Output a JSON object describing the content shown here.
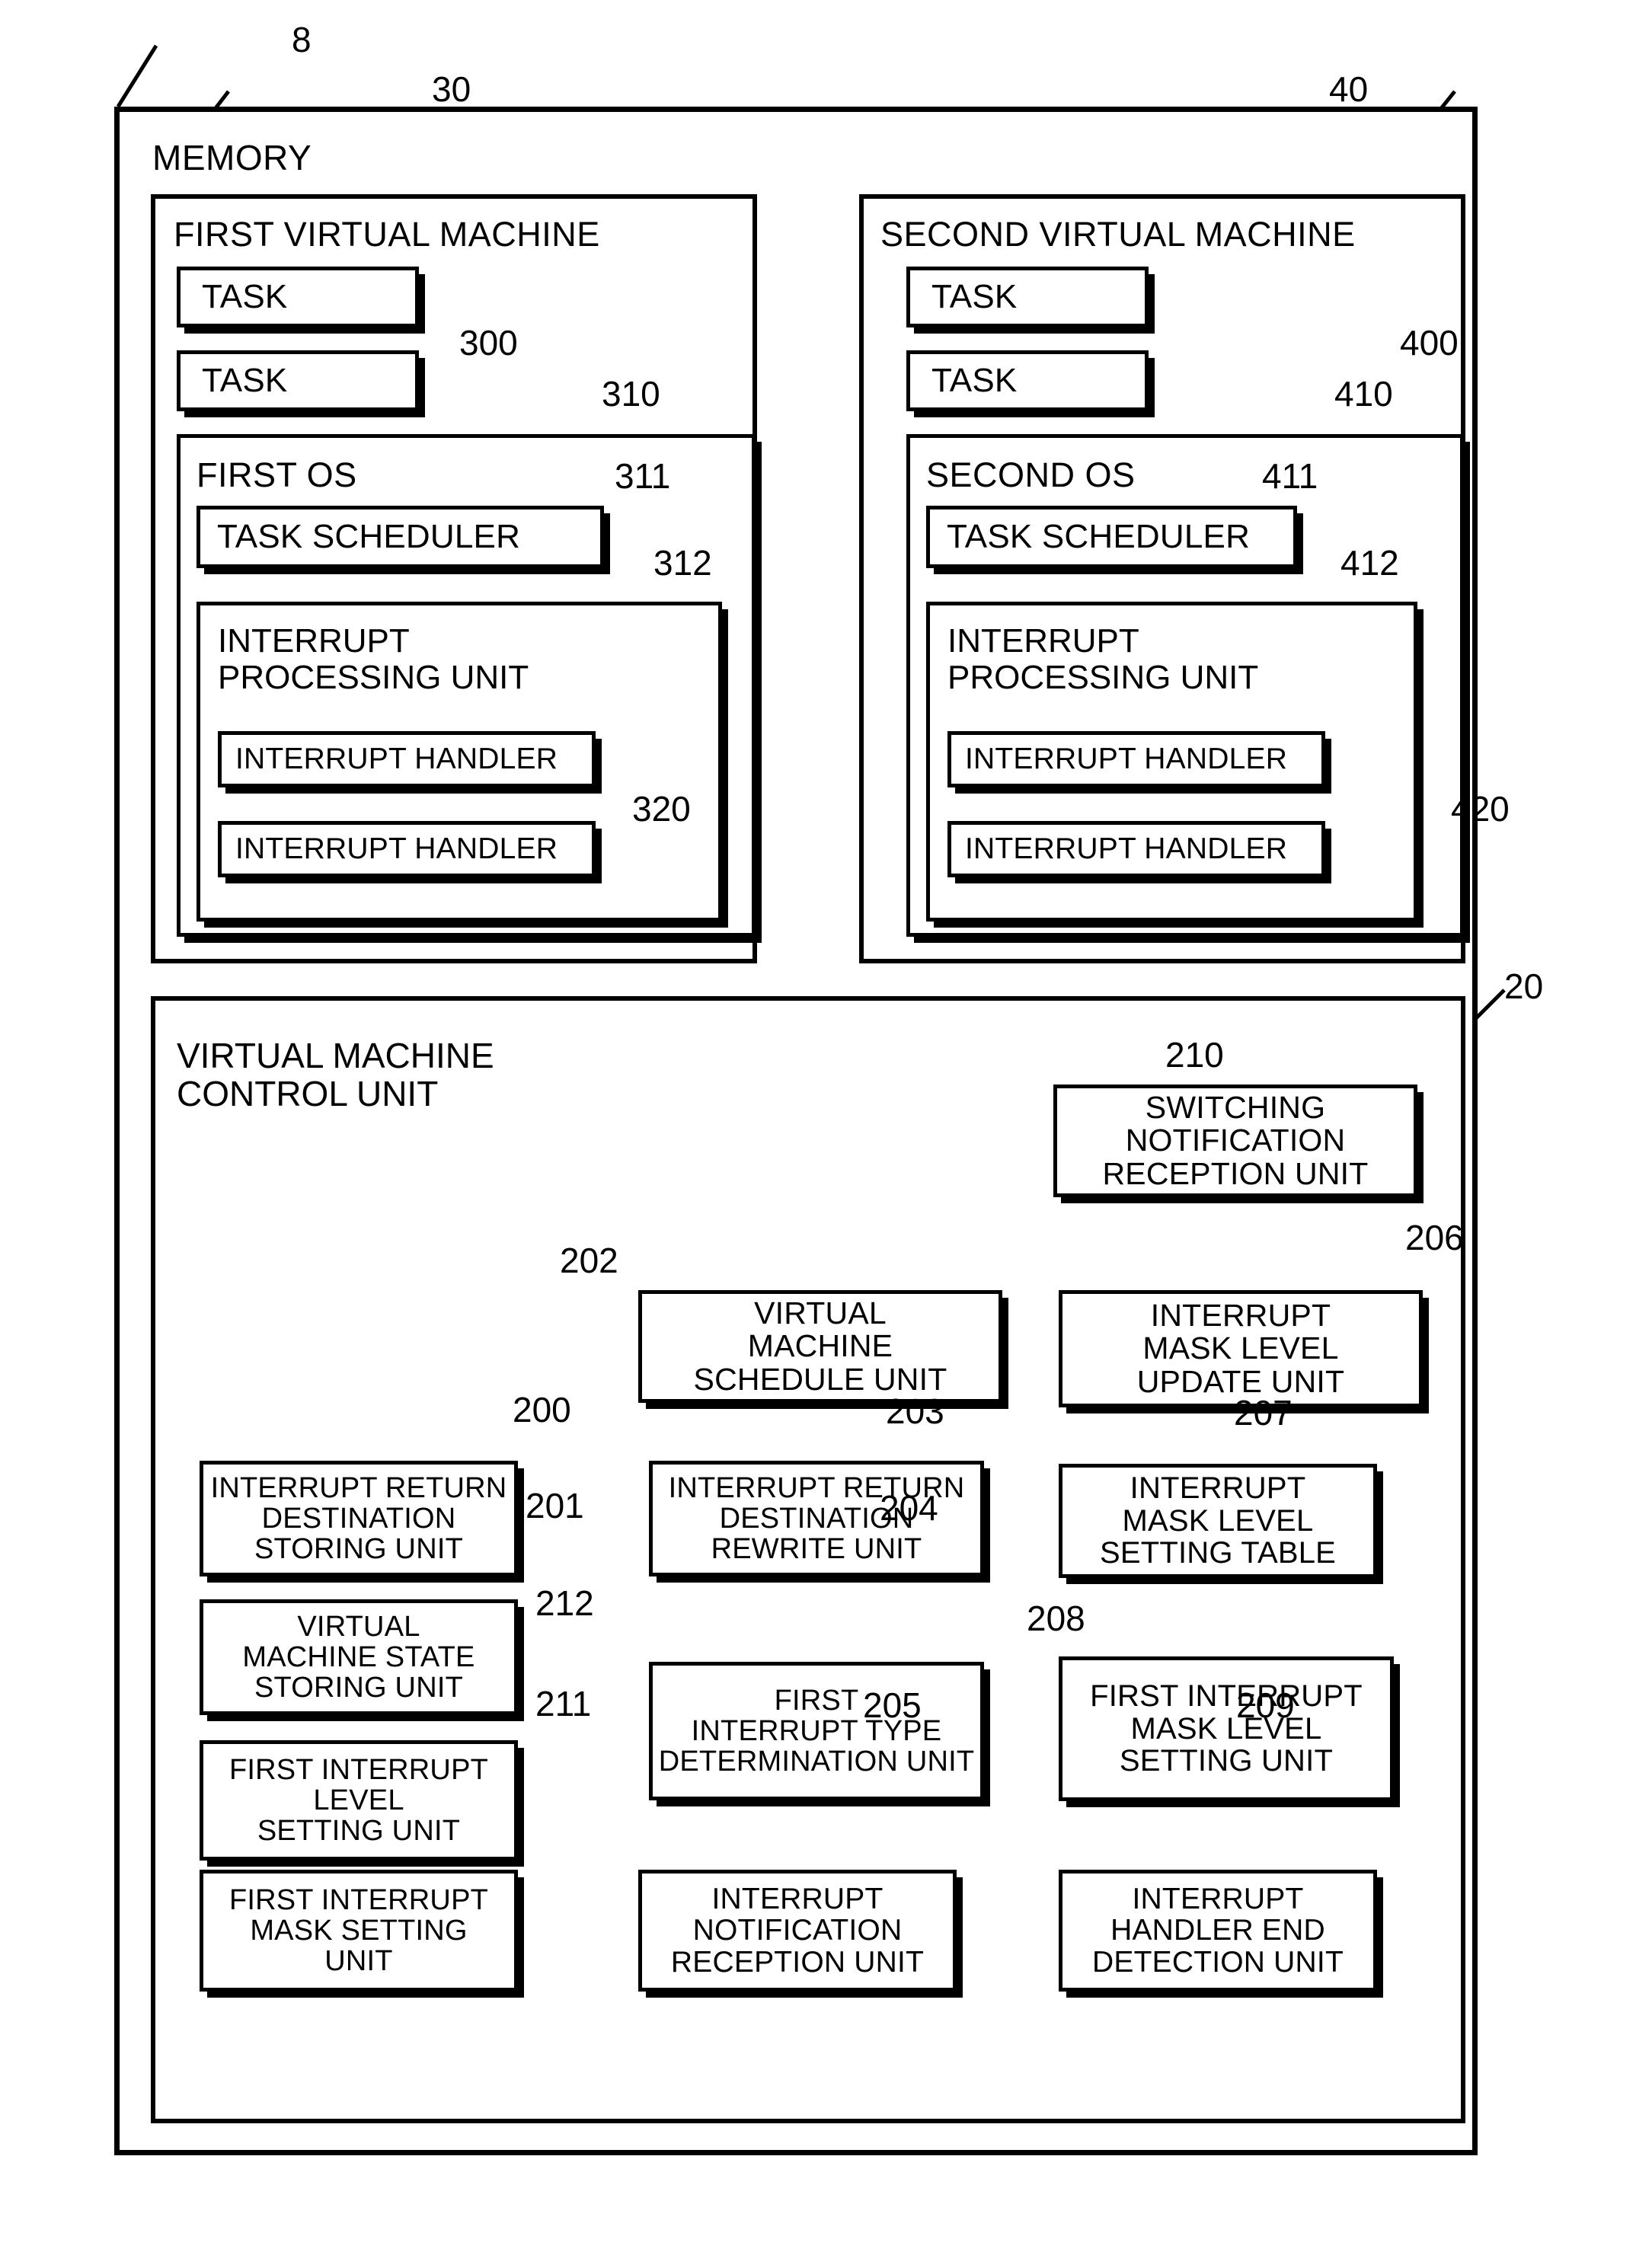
{
  "figure": {
    "outer_ref": "8",
    "memory_label": "MEMORY",
    "vmcu_ref": "20",
    "vmcu_label_line1": "VIRTUAL MACHINE",
    "vmcu_label_line2": "CONTROL UNIT"
  },
  "first_vm": {
    "ref": "30",
    "title": "FIRST VIRTUAL MACHINE",
    "tasks": [
      "TASK",
      "TASK"
    ],
    "tasks_ref": "300",
    "os": {
      "ref": "310",
      "title": "FIRST OS",
      "scheduler": {
        "ref": "311",
        "label": "TASK SCHEDULER"
      },
      "ipu": {
        "ref": "312",
        "label_line1": "INTERRUPT",
        "label_line2": "PROCESSING UNIT",
        "handlers": [
          "INTERRUPT HANDLER",
          "INTERRUPT HANDLER"
        ],
        "handlers_ref": "320"
      }
    }
  },
  "second_vm": {
    "ref": "40",
    "title": "SECOND VIRTUAL MACHINE",
    "tasks": [
      "TASK",
      "TASK"
    ],
    "tasks_ref": "400",
    "os": {
      "ref": "410",
      "title": "SECOND OS",
      "scheduler": {
        "ref": "411",
        "label": "TASK SCHEDULER"
      },
      "ipu": {
        "ref": "412",
        "label_line1": "INTERRUPT",
        "label_line2": "PROCESSING UNIT",
        "handlers": [
          "INTERRUPT HANDLER",
          "INTERRUPT HANDLER"
        ],
        "handlers_ref": "420"
      }
    }
  },
  "control_unit_blocks": [
    {
      "ref": "210",
      "label": "SWITCHING\nNOTIFICATION\nRECEPTION UNIT"
    },
    {
      "ref": "202",
      "label": "VIRTUAL\nMACHINE\nSCHEDULE UNIT"
    },
    {
      "ref": "206",
      "label": "INTERRUPT\nMASK LEVEL\nUPDATE UNIT"
    },
    {
      "ref": "200",
      "label": "INTERRUPT RETURN\nDESTINATION\nSTORING UNIT"
    },
    {
      "ref": "203",
      "label": "INTERRUPT RETURN\nDESTINATION\nREWRITE UNIT"
    },
    {
      "ref": "207",
      "label": "INTERRUPT\nMASK LEVEL\nSETTING TABLE"
    },
    {
      "ref": "201",
      "label": "VIRTUAL\nMACHINE STATE\nSTORING UNIT"
    },
    {
      "ref": "204",
      "label": "FIRST\nINTERRUPT TYPE\nDETERMINATION UNIT"
    },
    {
      "ref": "208",
      "label": "FIRST INTERRUPT\nMASK LEVEL\nSETTING UNIT"
    },
    {
      "ref": "212",
      "label": "FIRST INTERRUPT\nLEVEL\nSETTING UNIT"
    },
    {
      "ref": "205",
      "label": "INTERRUPT\nNOTIFICATION\nRECEPTION UNIT"
    },
    {
      "ref": "209",
      "label": "INTERRUPT\nHANDLER END\nDETECTION UNIT"
    },
    {
      "ref": "211",
      "label": "FIRST INTERRUPT\nMASK SETTING\nUNIT"
    }
  ],
  "colors": {
    "ink": "#000000",
    "paper": "#ffffff"
  }
}
